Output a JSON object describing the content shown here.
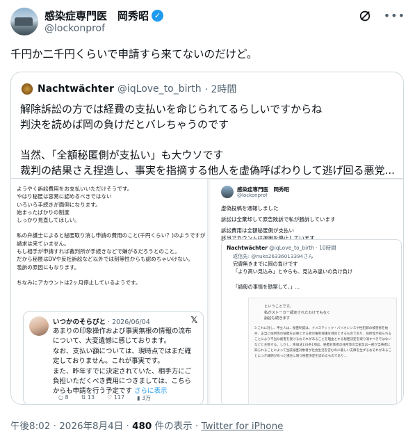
{
  "author": {
    "display_name": "感染症専門医　岡秀昭",
    "handle": "@lockonprof"
  },
  "tweet_text": "千円か二千円くらいで申請すら来てないのだけど。",
  "quote": {
    "display_name": "Nachtwächter",
    "handle": "@iqLove_to_birth",
    "time": "· 2時間",
    "lines": [
      "解除訴訟の方では経費の支払いを命じられてるらしいですからね",
      "判決を読めば岡の負けだとバレちゃうのです",
      "",
      "当然、「全額秘匿側が支払い」も大ウソです",
      "裁判の結果さえ捏造し、事実を指摘する他人を虚偽呼ばわりして逃げ回る悪党..."
    ]
  },
  "left_image": {
    "lines": [
      "ようやく訴訟費用をお支払いいただけそうです。",
      "やはり秘匿は容易に認めるべきではない",
      "いろいろ手続きが面倒になります。",
      "始まったばかりの制度",
      "しっかり見直してほしい。",
      "",
      "私の弁護士によると秘匿取り消し申請の費用のこと(千円くらい？)のようですが",
      "請求は来ていません。",
      "もし相手が申請すれば裁判所が手続きなどで嫌がるだろうとのこと。",
      "だから秘匿はDVや反社訴訟など以外では刻等性からも認めちゃいけない。",
      "濫訴の原因にもなります。",
      "",
      "ちなみにアカウントは2ヶ月停止しているようです。"
    ],
    "embed": {
      "name": "いつかのそらぴと",
      "date": "· 2026/06/04",
      "lines": [
        "あまりの印象操作および事実無根の情報の流布",
        "について、大変遺憾に感じております。",
        "なお、支払い額については、現時点ではまだ確",
        "定しておりません。これが事実です。",
        "また、昨年すでに決定されていた、相手方にご",
        "負担いただくべき費用につきましては、こちら",
        "からも申請を行う予定です"
      ],
      "more": "さらに表示",
      "actions": {
        "replies": "8",
        "reposts": "13",
        "likes": "117",
        "views": "3万"
      }
    }
  },
  "right_image": {
    "name": "感染症専門医　岡秀昭",
    "handle": "@lockonprof",
    "lines": [
      "虚偽投稿を通報しました",
      "",
      "訴訟は全棄却して原告敗訴で私が勝訴しています",
      "",
      "訴訟費用は全額秘匿側が支払い",
      "該当アカウントは運用を停止しています"
    ],
    "sub": {
      "name": "Nachtwächter",
      "meta": "@iqLove_to_birth · 10時間",
      "reply": "返信先: @nuko26336013394さん",
      "lines": [
        "完膚無きまでに岡の負けです",
        "「より高い見込み」とやらも、見込み違いの負け負け",
        "",
        "「請般の事情を勘案して、」..."
      ],
      "doc_lines": [
        "ということです。",
        "私がストーカー認定されたわけでもなく",
        "訴訟も続きます"
      ],
      "doc_dense": "3 これに対し、申立人は、秘匿制度は、ドメスティック・バイオレンスや性犯罪の被害者を始め、正当に住所等の秘匿を必要とする者の権利保護を目的とするものであり、住所等が知られることにより不当な被害を受けるおそれがあることを理由とする秘匿決定を取り消すべきではないなどと主張する。しかし、民訴法133条1項は、秘匿対象者の住所等の全部又は一部が当事者に知られることによって当該秘匿対象者が社会生活を営むのに著しい支障を生ずるおそれがあることにつき疎明があった場合に限り秘匿決定を認めるものであり…"
    }
  },
  "footer": {
    "time": "午後8:02 · 2026年8月4日 · ",
    "views_count": "480",
    "views_label": " 件の表示 · ",
    "source": "Twitter for iPhone"
  }
}
